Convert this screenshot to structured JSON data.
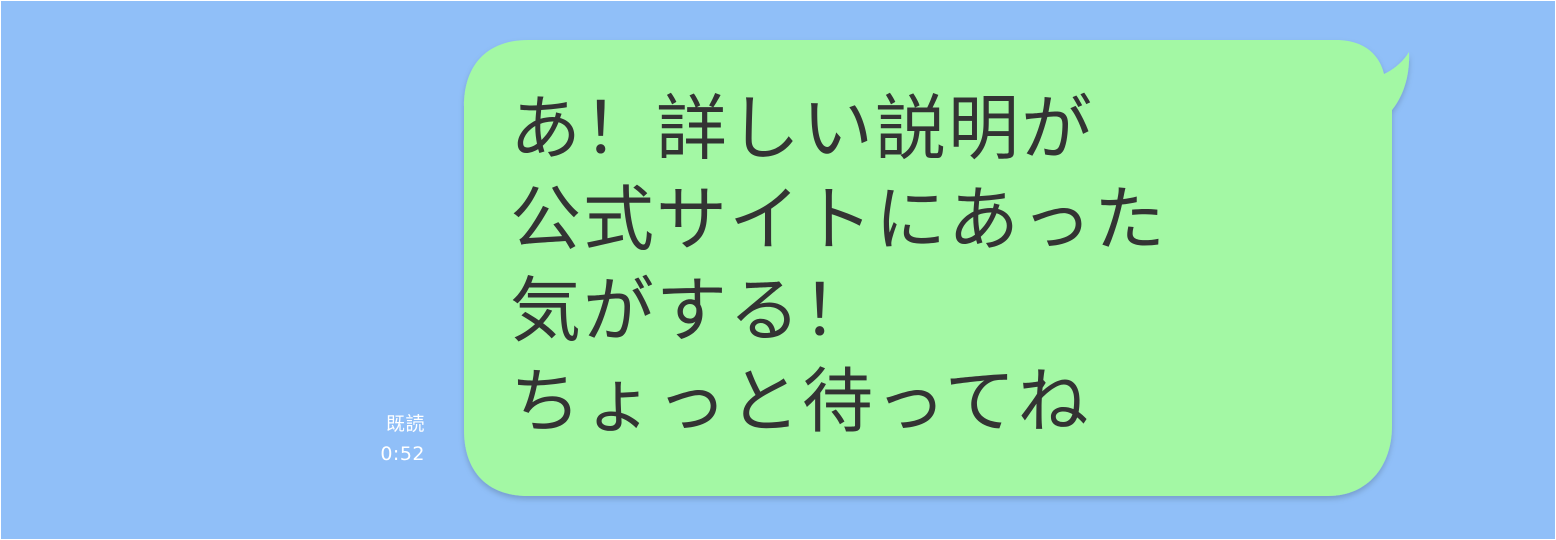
{
  "chat": {
    "message": {
      "lines": [
        "あ！詳しい説明が",
        "公式サイトにあった",
        "気がする！",
        "ちょっと待ってね"
      ],
      "read_status": "既読",
      "time": "0:52"
    }
  },
  "colors": {
    "background": "#90bff8",
    "bubble": "#a3f8a4",
    "text": "#333333",
    "meta_text": "#ffffff"
  }
}
